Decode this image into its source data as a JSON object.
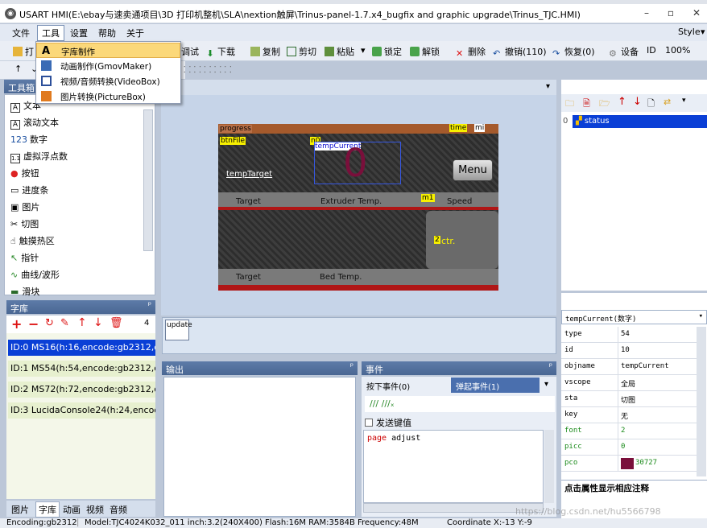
{
  "app": {
    "title": "USART HMI(E:\\ebay与速卖通项目\\3D 打印机整机\\SLA\\nextion触屏\\Trinus-panel-1.7.x4_bugfix and graphic upgrade\\Trinus_TJC.HMI)",
    "style_label": "Style"
  },
  "menu": [
    "文件",
    "工具",
    "设置",
    "帮助",
    "关于"
  ],
  "tools_dropdown": [
    {
      "label": "字库制作",
      "icon": "font-a-icon"
    },
    {
      "label": "动画制作(GmovMaker)",
      "icon": "film-icon"
    },
    {
      "label": "视频/音频转换(VideoBox)",
      "icon": "video-icon"
    },
    {
      "label": "图片转换(PictureBox)",
      "icon": "picture-icon"
    }
  ],
  "toolbar": {
    "debug": "调试",
    "download": "下载",
    "copy": "复制",
    "cut": "剪切",
    "paste": "粘贴",
    "lock": "锁定",
    "unlock": "解锁",
    "delete": "删除",
    "undo": "撤销(110)",
    "redo": "恢复(0)",
    "device": "设备",
    "id": "ID",
    "zoom": "100%"
  },
  "toolbox": {
    "title": "工具箱",
    "items": [
      "文本",
      "滚动文本",
      "数字",
      "虚拟浮点数",
      "按钮",
      "进度条",
      "图片",
      "切图",
      "触摸热区",
      "指针",
      "曲线/波形",
      "滑块"
    ],
    "icons": [
      "A",
      "A",
      "123",
      "1.1",
      "●",
      "▭",
      "▣",
      "✂",
      "☝",
      "↖",
      "∿",
      "▬"
    ]
  },
  "fonts": {
    "title": "字库",
    "count": "4",
    "items": [
      "ID:0  MS16(h:16,encode:gb2312,qty:9",
      "ID:1  MS54(h:54,encode:gb2312,qty:9",
      "ID:2  MS72(h:72,encode:gb2312,qty:9",
      "ID:3  LucidaConsole24(h:24,encode:g"
    ]
  },
  "bottom_tabs": [
    "图片",
    "字库",
    "动画",
    "视频",
    "音频"
  ],
  "canvas": {
    "progress": "progress",
    "time": "time",
    "min": "mi",
    "btnfile": "btnFile",
    "n0": "n0",
    "tempcurrent": "tempCurrent",
    "big_digit": "0",
    "temptarget": "tempTarget",
    "menu_btn": "Menu",
    "target1": "Target",
    "extruder": "Extruder Temp.",
    "m1": "m1",
    "speed": "Speed",
    "ctr": "ctr.",
    "target2": "Target",
    "bed": "Bed Temp.",
    "update": "update"
  },
  "output": {
    "title": "输出"
  },
  "events": {
    "title": "事件",
    "tab_press": "按下事件(0)",
    "tab_release": "弹起事件(1)",
    "send_key": "发送键值",
    "code_keyword": "page",
    "code_rest": " adjust"
  },
  "pages": {
    "title": "页面",
    "items": [
      {
        "index": "0",
        "name": "status"
      }
    ]
  },
  "props": {
    "title": "属性",
    "selector": "tempCurrent(数字)",
    "rows": [
      {
        "k": "type",
        "v": "54",
        "green": false
      },
      {
        "k": "id",
        "v": "10",
        "green": false
      },
      {
        "k": "objname",
        "v": "tempCurrent",
        "green": false
      },
      {
        "k": "vscope",
        "v": "全局",
        "green": false
      },
      {
        "k": "sta",
        "v": "切图",
        "green": false
      },
      {
        "k": "key",
        "v": "无",
        "green": false
      },
      {
        "k": "font",
        "v": "2",
        "green": true
      },
      {
        "k": "picc",
        "v": "0",
        "green": true
      },
      {
        "k": "pco",
        "v": "30727",
        "green": true
      }
    ],
    "hint": "点击属性显示相应注释"
  },
  "statusbar": {
    "encoding": "Encoding:gb2312",
    "model": "Model:TJC4024K032_011  inch:3.2(240X400) Flash:16M RAM:3584B Frequency:48M",
    "coord": "Coordinate X:-13  Y:-9",
    "watermark": "https://blog.csdn.net/hu5566798"
  },
  "colors": {
    "accent": "#3b6ea8",
    "pco_swatch": "#7a0f3b",
    "selected_row": "#0a3fd6",
    "highlight_yellow": "#f7f000"
  }
}
